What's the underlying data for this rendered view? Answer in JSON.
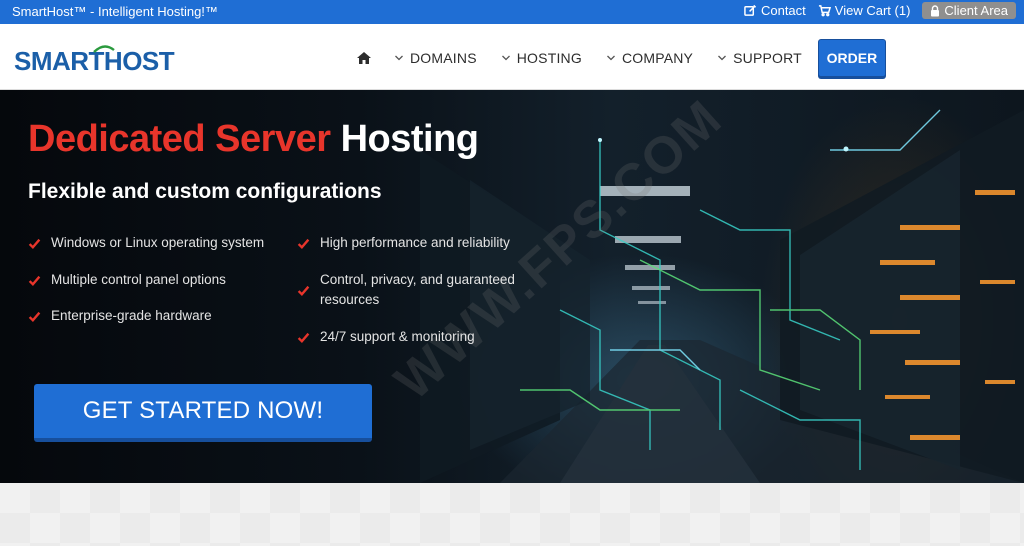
{
  "topbar": {
    "site_title": "SmartHost™ - Intelligent Hosting!™",
    "contact_label": "Contact",
    "cart_label": "View Cart (1)",
    "client_area_label": "Client Area",
    "background_color": "#1f6ed4"
  },
  "header": {
    "logo_text": "SMARTHOST",
    "nav_items": [
      {
        "label": "DOMAINS",
        "icon": "chevron-down-icon"
      },
      {
        "label": "HOSTING",
        "icon": "chevron-down-icon"
      },
      {
        "label": "COMPANY",
        "icon": "chevron-down-icon"
      },
      {
        "label": "SUPPORT",
        "icon": "chevron-down-icon"
      }
    ],
    "home_icon": "home-icon",
    "order_label": "ORDER"
  },
  "hero": {
    "title_red": "Dedicated Server",
    "title_white": "Hosting",
    "subtitle": "Flexible and custom configurations",
    "features_left": [
      "Windows or Linux operating system",
      "Multiple control panel options",
      "Enterprise-grade hardware"
    ],
    "features_right": [
      "High performance and reliability",
      "Control, privacy, and guaranteed resources",
      "24/7 support & monitoring"
    ],
    "cta_label": "GET STARTED NOW!",
    "watermark": "WWW.FPS.COM",
    "accent_red": "#e8352b",
    "accent_blue": "#1f6ed4"
  }
}
